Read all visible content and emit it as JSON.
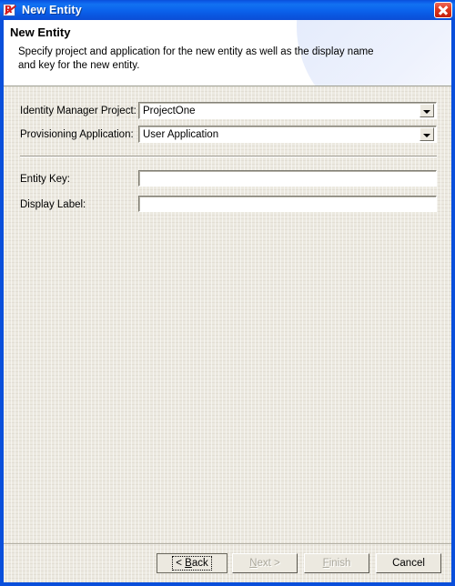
{
  "window": {
    "title": "New Entity",
    "icon": "entity-icon",
    "close_label": "Close",
    "close_icon": "close-icon"
  },
  "header": {
    "title": "New Entity",
    "description": "Specify project and application for the new entity as well as the display name and key for the new entity."
  },
  "form": {
    "fields": [
      {
        "label": "Identity Manager Project:",
        "type": "combo",
        "value": "ProjectOne",
        "name": "identity-manager-project"
      },
      {
        "label": "Provisioning Application:",
        "type": "combo",
        "value": "User Application",
        "name": "provisioning-application"
      },
      {
        "label": "Entity Key:",
        "type": "text",
        "value": "",
        "placeholder": "",
        "name": "entity-key"
      },
      {
        "label": "Display Label:",
        "type": "text",
        "value": "",
        "placeholder": "",
        "name": "display-label"
      }
    ]
  },
  "buttons": {
    "back": {
      "label": "< Back",
      "mnemonic": "B",
      "state": "default-focused"
    },
    "next": {
      "label": "Next >",
      "mnemonic": "N",
      "state": "disabled"
    },
    "finish": {
      "label": "Finish",
      "mnemonic": "F",
      "state": "disabled"
    },
    "cancel": {
      "label": "Cancel",
      "state": "enabled"
    }
  },
  "colors": {
    "titlebar_blue": "#0b63ec",
    "frame_blue": "#0a4fdb",
    "panel_beige": "#ece9e0",
    "header_white": "#ffffff",
    "close_red": "#c41d08",
    "disabled_text": "#aaa79b"
  }
}
